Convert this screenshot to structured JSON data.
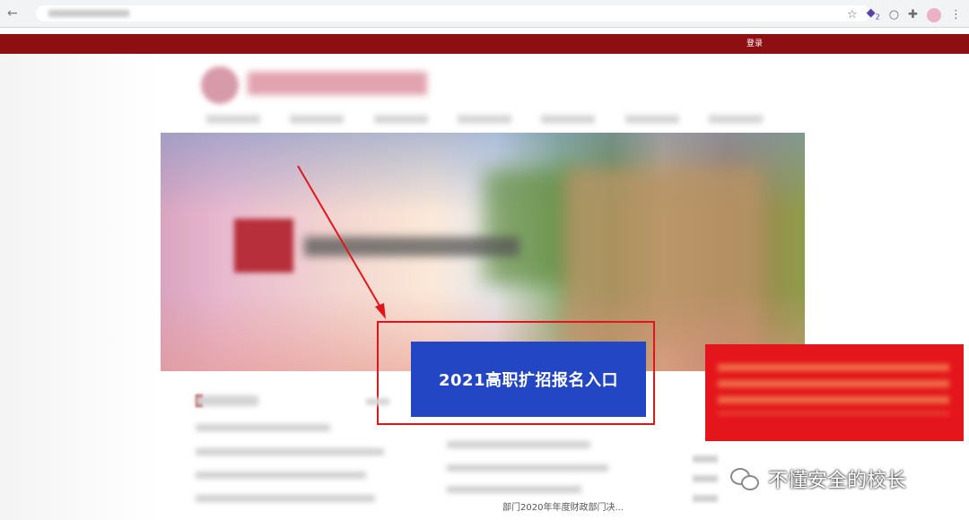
{
  "browser": {
    "icons": [
      "star-icon",
      "extension-badge-icon",
      "circle-icon",
      "puzzle-icon",
      "avatar",
      "menu-dots-icon"
    ],
    "badge_count": "2"
  },
  "topbar": {
    "login_label": "登录",
    "bar_color": "#8e0f12"
  },
  "banner": {
    "highlight_button_label": "2021高职扩招报名入口",
    "button_color": "#2346c4",
    "highlight_box_color": "#e0161a"
  },
  "notice": {
    "color": "#e4161c"
  },
  "news": {
    "bottom_item_text": "部门2020年年度财政部门决..."
  },
  "watermark": {
    "text": "不懂安全的校长"
  }
}
